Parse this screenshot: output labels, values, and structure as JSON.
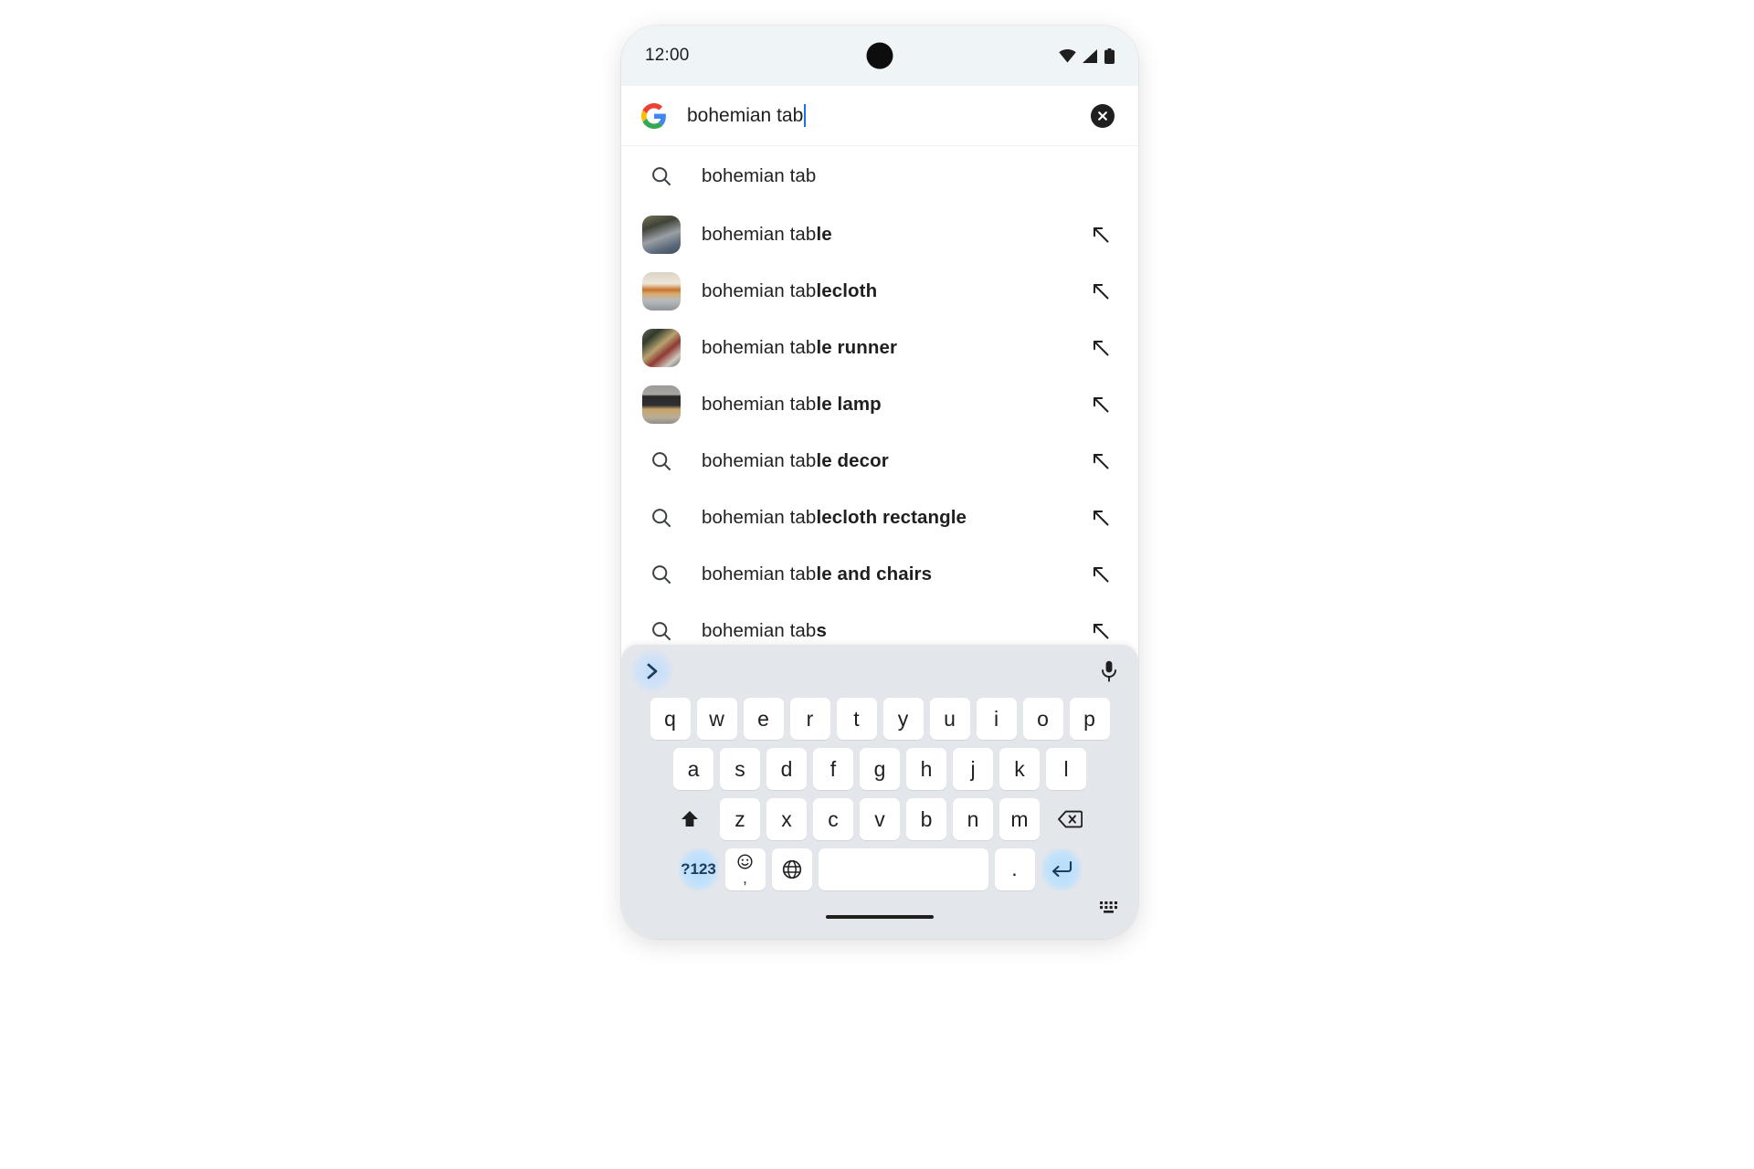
{
  "status_bar": {
    "time": "12:00",
    "icons": [
      "wifi-icon",
      "cell-signal-icon",
      "battery-icon"
    ]
  },
  "search_bar": {
    "brand_icon": "google-g-icon",
    "query": "bohemian tab",
    "clear_icon": "clear-circle-icon"
  },
  "suggestions": [
    {
      "lead": "search-icon",
      "prefix": "bohemian tab",
      "completion": "",
      "has_arrow": false
    },
    {
      "lead": "thumbnail",
      "prefix": "bohemian tab",
      "completion": "le",
      "has_arrow": true
    },
    {
      "lead": "thumbnail",
      "prefix": "bohemian tab",
      "completion": "lecloth",
      "has_arrow": true
    },
    {
      "lead": "thumbnail",
      "prefix": "bohemian tab",
      "completion": "le runner",
      "has_arrow": true
    },
    {
      "lead": "thumbnail",
      "prefix": "bohemian tab",
      "completion": "le lamp",
      "has_arrow": true
    },
    {
      "lead": "search-icon",
      "prefix": "bohemian tab",
      "completion": "le decor",
      "has_arrow": true
    },
    {
      "lead": "search-icon",
      "prefix": "bohemian tab",
      "completion": "lecloth rectangle",
      "has_arrow": true
    },
    {
      "lead": "search-icon",
      "prefix": "bohemian tab",
      "completion": "le and chairs",
      "has_arrow": true
    },
    {
      "lead": "search-icon",
      "prefix": "bohemian tab",
      "completion": "s",
      "has_arrow": true
    }
  ],
  "keyboard": {
    "toolbar": {
      "expand_icon": "chevron-right-icon",
      "mic_icon": "microphone-icon"
    },
    "row1": [
      "q",
      "w",
      "e",
      "r",
      "t",
      "y",
      "u",
      "i",
      "o",
      "p"
    ],
    "row2": [
      "a",
      "s",
      "d",
      "f",
      "g",
      "h",
      "j",
      "k",
      "l"
    ],
    "row3_letters": [
      "z",
      "x",
      "c",
      "v",
      "b",
      "n",
      "m"
    ],
    "shift_icon": "shift-icon",
    "backspace_icon": "backspace-icon",
    "symbols_label": "?123",
    "emoji_icon": "emoji-icon",
    "comma_label": ",",
    "globe_icon": "globe-icon",
    "space_label": "",
    "period_label": ".",
    "enter_icon": "enter-icon",
    "hide_keyboard_icon": "hide-keyboard-icon"
  },
  "colors": {
    "accent_blue": "#1a73e8",
    "key_blue_tint": "#b6dcfb",
    "keyboard_bg": "#e3e6eb",
    "status_bg": "#eff4f7",
    "text": "#1f1f1f"
  }
}
